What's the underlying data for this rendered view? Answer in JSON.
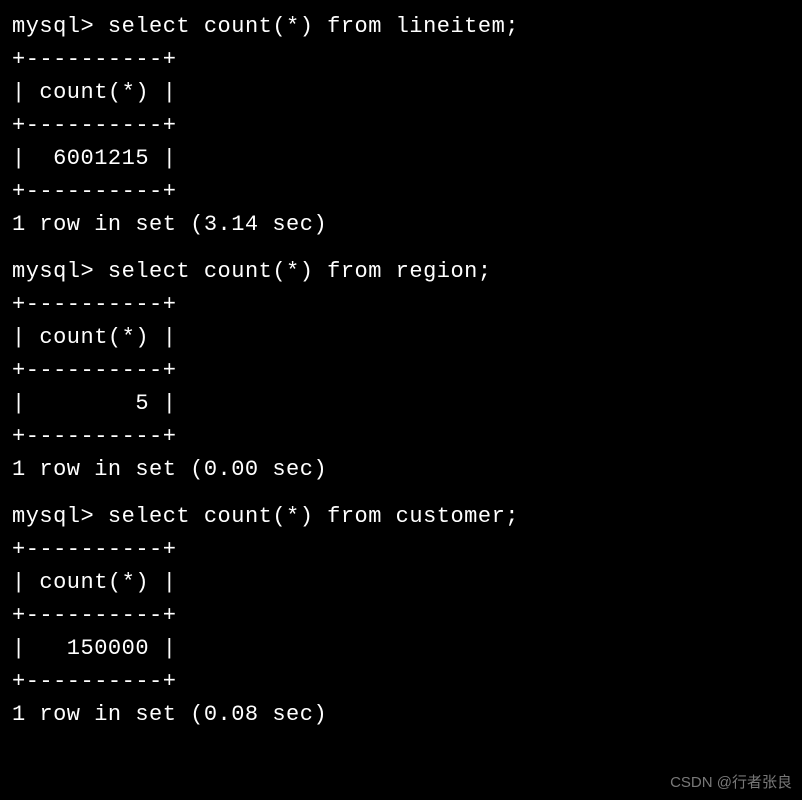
{
  "prompt": "mysql>",
  "queries": [
    {
      "command": "select count(*) from lineitem;",
      "border": "+----------+",
      "header": "| count(*) |",
      "value": "|  6001215 |",
      "summary": "1 row in set (3.14 sec)"
    },
    {
      "command": "select count(*) from region;",
      "border": "+----------+",
      "header": "| count(*) |",
      "value": "|        5 |",
      "summary": "1 row in set (0.00 sec)"
    },
    {
      "command": "select count(*) from customer;",
      "border": "+----------+",
      "header": "| count(*) |",
      "value": "|   150000 |",
      "summary": "1 row in set (0.08 sec)"
    }
  ],
  "watermark": "CSDN @行者张良"
}
